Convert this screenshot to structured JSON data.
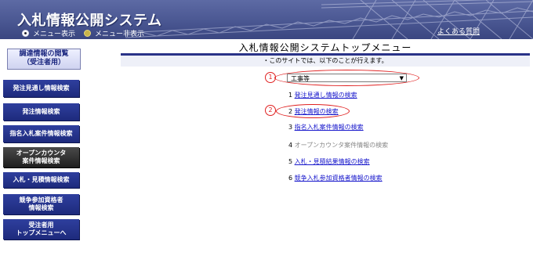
{
  "header": {
    "app_title": "入札情報公開システム",
    "menu_show": "メニュー表示",
    "menu_hide": "メニュー非表示",
    "faq": "よくある質問"
  },
  "sidebar": {
    "heading_line1": "調達情報の閲覧",
    "heading_line2": "（受注者用）",
    "items": [
      {
        "line1": "発注見通し情報検索",
        "line2": ""
      },
      {
        "line1": "発注情報検索",
        "line2": ""
      },
      {
        "line1": "指名入札案件情報検索",
        "line2": ""
      },
      {
        "line1": "オープンカウンタ",
        "line2": "案件情報検索"
      },
      {
        "line1": "入札・見積情報検索",
        "line2": ""
      },
      {
        "line1": "競争参加資格者",
        "line2": "情報検索"
      },
      {
        "line1": "受注者用",
        "line2": "トップメニューへ"
      }
    ]
  },
  "main": {
    "title": "入札情報公開システムトップメニュー",
    "info": "・このサイトでは、以下のことが行えます。",
    "marker1": "1",
    "marker2": "2",
    "select_value": "工事等",
    "items": [
      {
        "num": "1",
        "label": "発注見通し情報の検索"
      },
      {
        "num": "2",
        "label": "発注情報の検索"
      },
      {
        "num": "3",
        "label": "指名入札案件情報の検索"
      },
      {
        "num": "4",
        "label": "オープンカウンタ案件情報の検索"
      },
      {
        "num": "5",
        "label": "入札・見積結果情報の検索"
      },
      {
        "num": "6",
        "label": "競争入札参加資格者情報の検索"
      }
    ]
  },
  "colors": {
    "header_blue": "#4a5792",
    "nav_blue": "#1d2a7c",
    "nav_dark": "#1e1e1e",
    "link": "#1a1acc",
    "annotation_red": "#e02020"
  }
}
